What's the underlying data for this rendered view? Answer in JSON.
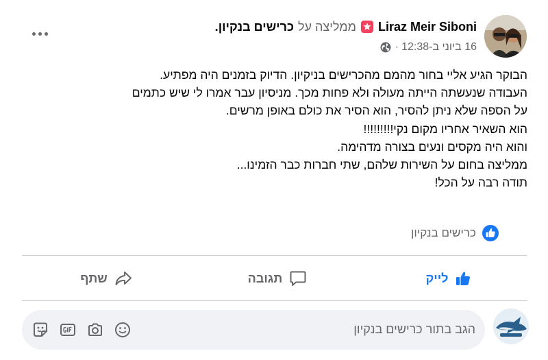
{
  "post": {
    "author": "Liraz Meir Siboni",
    "recommends_text": "ממליצה על",
    "page_name": "כרישים בנקיון",
    "period": ".",
    "timestamp": "16 ביוני ב-12:38",
    "timestamp_sep": "·",
    "privacy_icon": "globe-icon",
    "body_lines": [
      "הבוקר הגיע אליי בחור מהמם מהכרישים בניקיון. הדיוק בזמנים היה מפתיע.",
      "העבודה שנעשתה הייתה מעולה ולא פחות מכך. מניסיון עבר אמרו לי שיש כתמים",
      "על הספה שלא ניתן להסיר, הוא הסיר את כולם באופן מרשים.",
      "הוא השאיר אחריו מקום נקי!!!!!!!!!",
      "והוא היה מקסים ונעים בצורה מדהימה.",
      "ממליצה בחום על השירות שלהם, שתי חברות כבר הזמינו...",
      "תודה רבה על הכל!"
    ]
  },
  "reactions": {
    "label": "כרישים בנקיון",
    "icon": "like-reaction-icon",
    "accent_color": "#1877f2"
  },
  "actions": {
    "like_label": "לייק",
    "comment_label": "תגובה",
    "share_label": "שתף"
  },
  "composer": {
    "placeholder": "הגב בתור כרישים בנקיון",
    "icons": [
      "sticker-icon",
      "gif-icon",
      "camera-icon",
      "emoji-icon"
    ]
  }
}
